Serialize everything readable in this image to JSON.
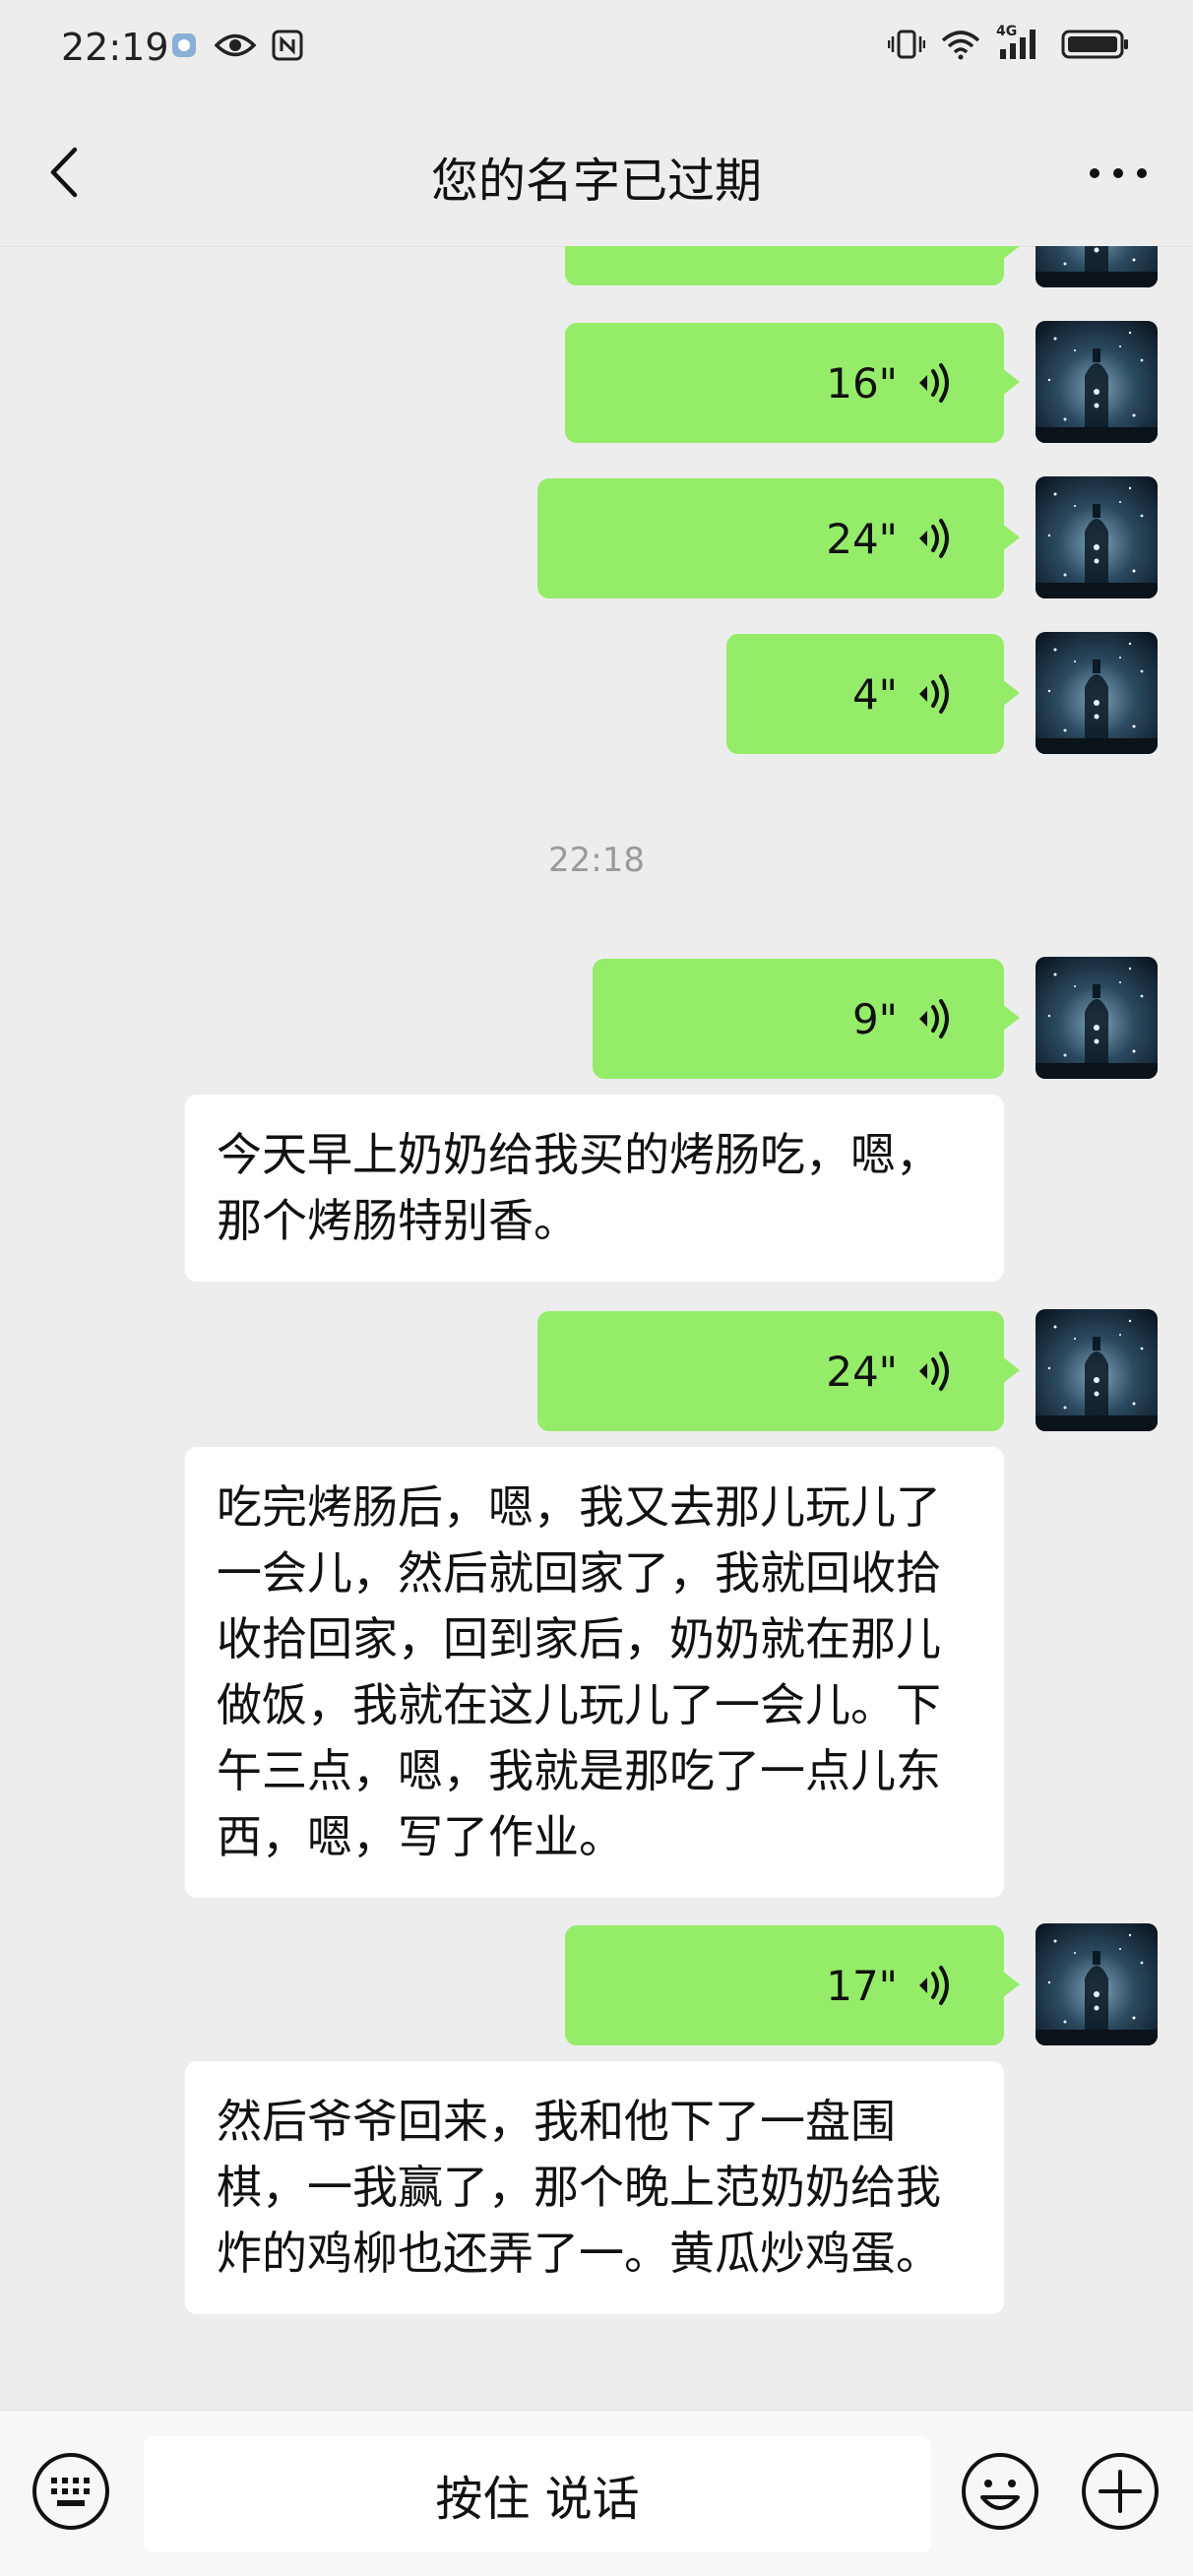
{
  "status_bar": {
    "time": "22:19",
    "left_icons": [
      "app-notification-icon",
      "eye-icon",
      "nfc-icon"
    ],
    "right_icons": [
      "vibrate-icon",
      "wifi-icon",
      "signal-4g-icon",
      "battery-icon"
    ],
    "network_label": "4G"
  },
  "header": {
    "title": "您的名字已过期",
    "back_icon": "chevron-left-icon",
    "more_icon": "more-dots-icon"
  },
  "colors": {
    "background": "#ededed",
    "sent_bubble": "#95ec69",
    "received_bubble": "#ffffff",
    "timestamp_text": "#9a9a9a"
  },
  "messages": [
    {
      "type": "voice",
      "duration": "16\""
    },
    {
      "type": "voice",
      "duration": "24\""
    },
    {
      "type": "voice",
      "duration": "4\""
    },
    {
      "type": "timestamp",
      "text": "22:18"
    },
    {
      "type": "voice",
      "duration": "9\""
    },
    {
      "type": "transcript",
      "text": "今天早上奶奶给我买的烤肠吃，嗯，那个烤肠特别香。"
    },
    {
      "type": "voice",
      "duration": "24\""
    },
    {
      "type": "transcript",
      "text": "吃完烤肠后，嗯，我又去那儿玩儿了一会儿，然后就回家了，我就回收拾收拾回家，回到家后，奶奶就在那儿做饭，我就在这儿玩儿了一会儿。下午三点，嗯，我就是那吃了一点儿东西，嗯，写了作业。"
    },
    {
      "type": "voice",
      "duration": "17\""
    },
    {
      "type": "transcript",
      "text": "然后爷爷回来，我和他下了一盘围棋，一我赢了，那个晚上范奶奶给我炸的鸡柳也还弄了一。黄瓜炒鸡蛋。"
    }
  ],
  "input_bar": {
    "hold_to_talk": "按住 说话",
    "keyboard_icon": "keyboard-icon",
    "emoji_icon": "emoji-icon",
    "plus_icon": "plus-icon"
  }
}
